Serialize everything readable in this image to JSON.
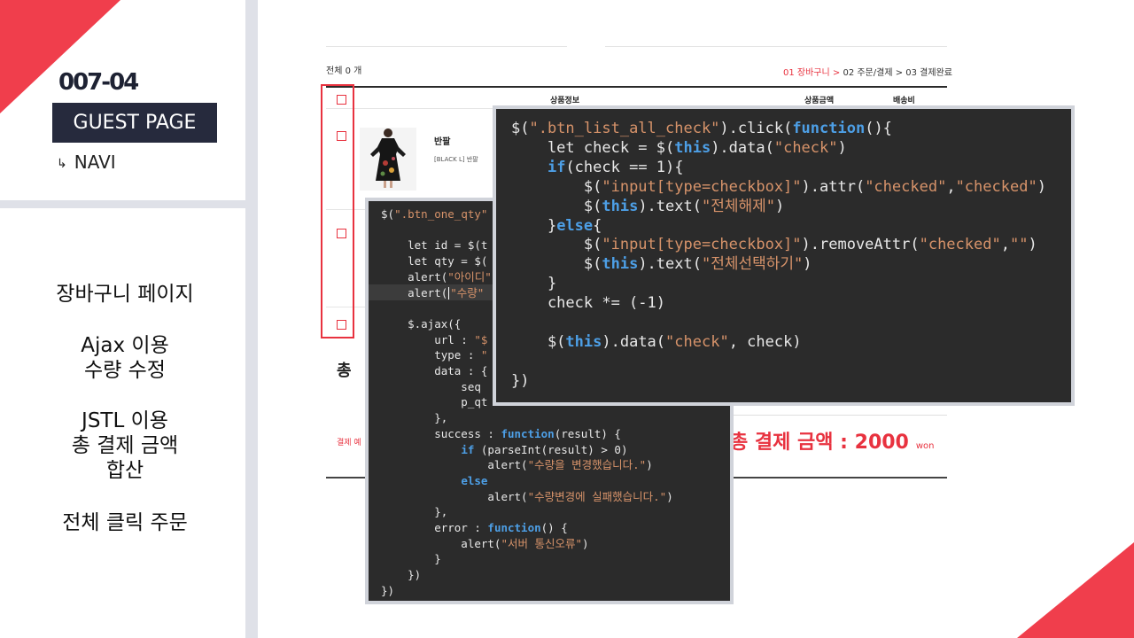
{
  "slide": {
    "number": "007-04",
    "badge": "GUEST PAGE",
    "navi_arrow": "↳",
    "navi_label": "NAVI",
    "features": [
      "장바구니 페이지",
      "Ajax 이용\n수량 수정",
      "JSTL 이용\n총 결제 금액\n합산",
      "전체 클릭 주문"
    ]
  },
  "cart": {
    "count_label": "전체 0 개",
    "steps": {
      "step1": "01 장바구니 >",
      "step2": "02 주문/결제 >",
      "step3": "03 결제완료"
    },
    "columns": {
      "product_info": "상품정보",
      "product_price": "상품금액",
      "shipping": "배송비"
    },
    "product": {
      "name": "반팔",
      "option": "[BLACK L] 반팔"
    },
    "total_partial": "총 ",
    "pay_partial": "결제 예",
    "grand_total": "총 결제 금액 : 2000",
    "currency": "won"
  },
  "code_back": {
    "lines": [
      "$(\".btn_one_qty\"",
      "",
      "    let id = $(t",
      "    let qty = $(",
      "    alert(\"아이디\"",
      "    alert(",
      "",
      "    $.ajax({",
      "        url : \"$",
      "        type : \"",
      "        data : {",
      "            seq",
      "            p_qt",
      "        },",
      "        success : function(result) {",
      "            if (parseInt(result) > 0)",
      "                alert(\"수량을 변경했습니다.\")",
      "            else",
      "                alert(\"수량변경에 실패했습니다.\")",
      "        },",
      "        error : function() {",
      "            alert(\"서버 통신오류\")",
      "        }",
      "    })",
      "})"
    ],
    "line6_tail": "\"수량\""
  },
  "code_front": {
    "lines": [
      "$(\".btn_list_all_check\").click(function(){",
      "    let check = $(this).data(\"check\")",
      "    if(check == 1){",
      "        $(\"input[type=checkbox]\").attr(\"checked\",\"checked\")",
      "        $(this).text(\"전체해제\")",
      "    }else{",
      "        $(\"input[type=checkbox]\").removeAttr(\"checked\",\"\")",
      "        $(this).text(\"전체선택하기\")",
      "    }",
      "    check *= (-1)",
      "",
      "    $(this).data(\"check\", check)",
      "",
      "})"
    ]
  },
  "colors": {
    "accent": "#f03e4c",
    "badge_bg": "#262a3d",
    "code_bg": "#2b2b2b",
    "keyword": "#4d9fe6",
    "string": "#d7936a"
  }
}
